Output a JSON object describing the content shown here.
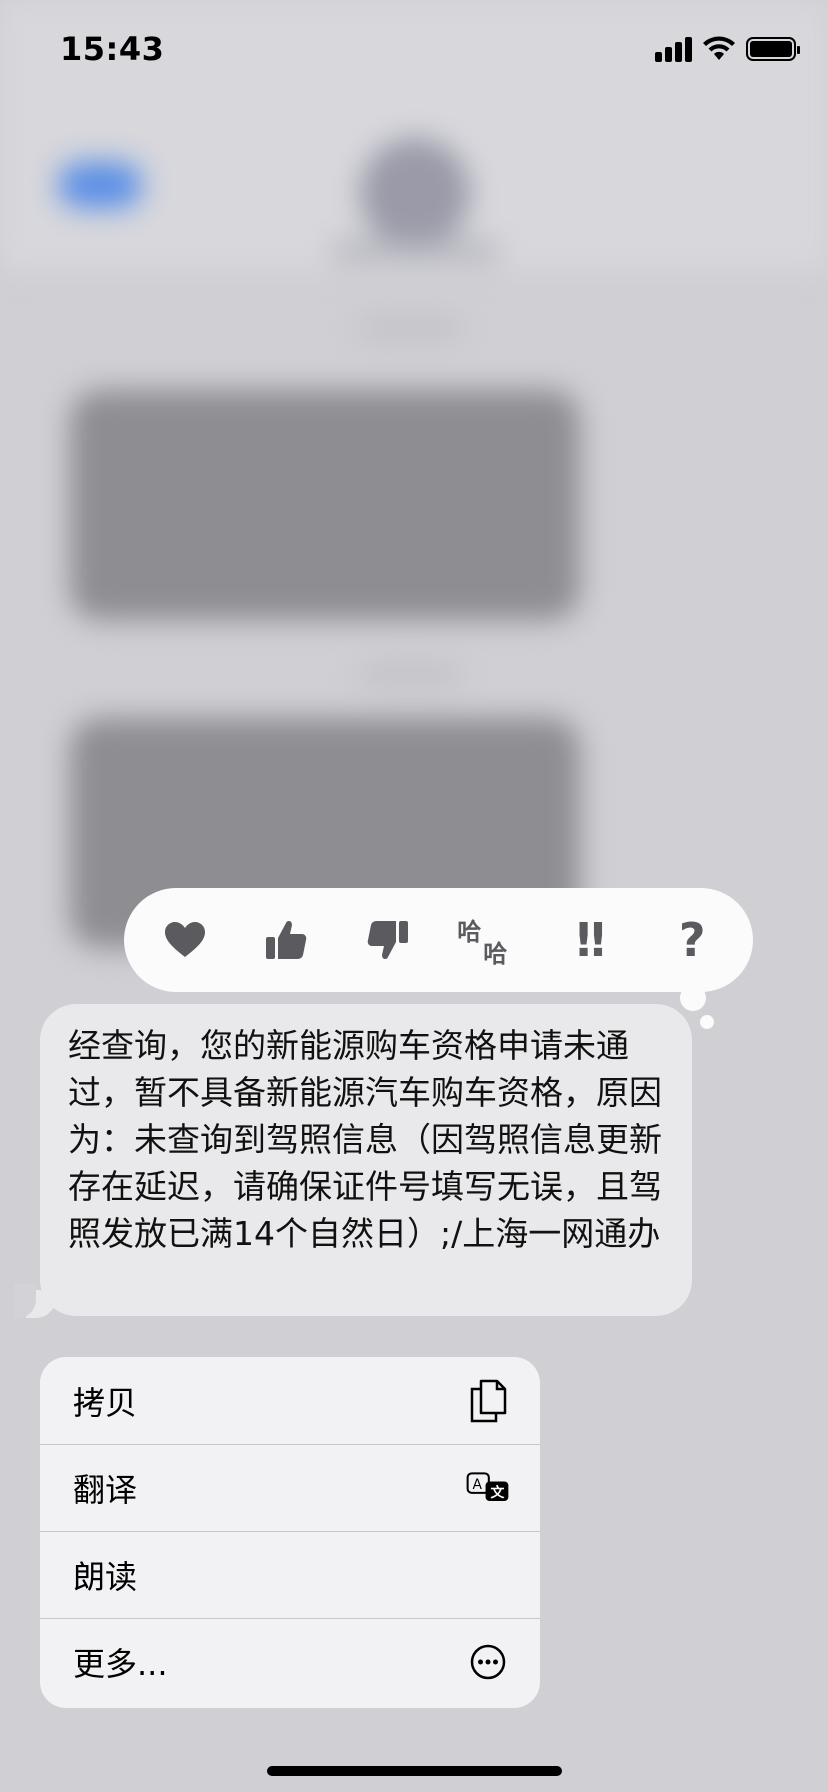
{
  "status_bar": {
    "time": "15:43"
  },
  "reactions": [
    {
      "name": "heart-icon"
    },
    {
      "name": "thumbs-up-icon"
    },
    {
      "name": "thumbs-down-icon"
    },
    {
      "name": "haha-icon",
      "text_1": "哈",
      "text_2": "哈"
    },
    {
      "name": "exclamation-icon",
      "text": "‼"
    },
    {
      "name": "question-icon",
      "text": "?"
    }
  ],
  "message": {
    "text": "经查询，您的新能源购车资格申请未通过，暂不具备新能源汽车购车资格，原因为：未查询到驾照信息（因驾照信息更新存在延迟，请确保证件号填写无误，且驾照发放已满14个自然日）;/上海一网通办"
  },
  "context_menu": {
    "copy_label": "拷贝",
    "translate_label": "翻译",
    "speak_label": "朗读",
    "more_label": "更多..."
  },
  "colors": {
    "bubble": "#e9e9eb",
    "reaction_icon": "#5a5a5f",
    "menu_background": "#f2f2f4"
  }
}
